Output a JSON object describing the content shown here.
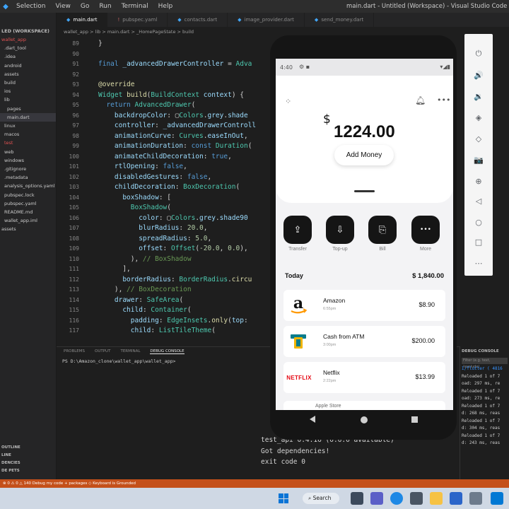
{
  "window": {
    "menu": [
      "Selection",
      "View",
      "Go",
      "Run",
      "Terminal",
      "Help"
    ],
    "title": "main.dart - Untitled (Workspace) - Visual Studio Code"
  },
  "explorer": {
    "workspace_title": "LED (WORKSPACE)",
    "items": [
      {
        "label": "wallet_app",
        "color": "red"
      },
      {
        "label": ".dart_tool"
      },
      {
        "label": ".idea"
      },
      {
        "label": "android"
      },
      {
        "label": "assets"
      },
      {
        "label": "build"
      },
      {
        "label": "ios"
      },
      {
        "label": "lib"
      },
      {
        "label": "pages"
      },
      {
        "label": "main.dart",
        "selected": true
      },
      {
        "label": "linux"
      },
      {
        "label": "macos"
      },
      {
        "label": "test",
        "color": "red"
      },
      {
        "label": "web"
      },
      {
        "label": "windows"
      },
      {
        "label": ".gitignore"
      },
      {
        "label": ".metadata"
      },
      {
        "label": "analysis_options.yaml"
      },
      {
        "label": "pubspec.lock"
      },
      {
        "label": "pubspec.yaml"
      },
      {
        "label": "README.md"
      },
      {
        "label": "wallet_app.iml"
      },
      {
        "label": "assets"
      }
    ],
    "bottom_sections": [
      "OUTLINE",
      "LINE",
      "DENCIES",
      "DE PETS"
    ]
  },
  "tabs": [
    {
      "label": "main.dart",
      "active": true
    },
    {
      "label": "pubspec.yaml"
    },
    {
      "label": "contacts.dart"
    },
    {
      "label": "image_provider.dart"
    },
    {
      "label": "send_money.dart"
    }
  ],
  "breadcrumb": "wallet_app > lib > main.dart > _HomePageState > build",
  "editor": {
    "lines": [
      {
        "n": "89",
        "html": "}"
      },
      {
        "n": "90",
        "html": ""
      },
      {
        "n": "91",
        "html": "<span class=\"kw\">final</span> <span class=\"va\">_advancedDrawerController</span> = <span class=\"ty\">Adva</span>"
      },
      {
        "n": "92",
        "html": ""
      },
      {
        "n": "93",
        "html": "<span class=\"fn\">@override</span>"
      },
      {
        "n": "94",
        "html": "<span class=\"ty\">Widget</span> <span class=\"fn\">build</span>(<span class=\"ty\">BuildContext</span> <span class=\"va\">context</span>) {"
      },
      {
        "n": "95",
        "html": "&nbsp;&nbsp;<span class=\"kw\">return</span> <span class=\"ty\">AdvancedDrawer</span>("
      },
      {
        "n": "96",
        "html": "&nbsp;&nbsp;&nbsp;&nbsp;<span class=\"pr\">backdropColor</span>: ▢<span class=\"ty\">Colors</span>.<span class=\"va\">grey</span>.<span class=\"va\">shade</span>"
      },
      {
        "n": "97",
        "html": "&nbsp;&nbsp;&nbsp;&nbsp;<span class=\"pr\">controller</span>: <span class=\"va\">_advancedDrawerControll</span>"
      },
      {
        "n": "98",
        "html": "&nbsp;&nbsp;&nbsp;&nbsp;<span class=\"pr\">animationCurve</span>: <span class=\"ty\">Curves</span>.<span class=\"va\">easeInOut</span>,"
      },
      {
        "n": "99",
        "html": "&nbsp;&nbsp;&nbsp;&nbsp;<span class=\"pr\">animationDuration</span>: <span class=\"kw\">const</span> <span class=\"ty\">Duration</span>("
      },
      {
        "n": "100",
        "html": "&nbsp;&nbsp;&nbsp;&nbsp;<span class=\"pr\">animateChildDecoration</span>: <span class=\"kw\">true</span>,"
      },
      {
        "n": "101",
        "html": "&nbsp;&nbsp;&nbsp;&nbsp;<span class=\"pr\">rtlOpening</span>: <span class=\"kw\">false</span>,"
      },
      {
        "n": "102",
        "html": "&nbsp;&nbsp;&nbsp;&nbsp;<span class=\"pr\">disabledGestures</span>: <span class=\"kw\">false</span>,"
      },
      {
        "n": "103",
        "html": "&nbsp;&nbsp;&nbsp;&nbsp;<span class=\"pr\">childDecoration</span>: <span class=\"ty\">BoxDecoration</span>("
      },
      {
        "n": "104",
        "html": "&nbsp;&nbsp;&nbsp;&nbsp;&nbsp;&nbsp;<span class=\"pr\">boxShadow</span>: ["
      },
      {
        "n": "105",
        "html": "&nbsp;&nbsp;&nbsp;&nbsp;&nbsp;&nbsp;&nbsp;&nbsp;<span class=\"ty\">BoxShadow</span>("
      },
      {
        "n": "106",
        "html": "&nbsp;&nbsp;&nbsp;&nbsp;&nbsp;&nbsp;&nbsp;&nbsp;&nbsp;&nbsp;<span class=\"pr\">color</span>: ▢<span class=\"ty\">Colors</span>.<span class=\"va\">grey</span>.<span class=\"va\">shade90</span>"
      },
      {
        "n": "107",
        "html": "&nbsp;&nbsp;&nbsp;&nbsp;&nbsp;&nbsp;&nbsp;&nbsp;&nbsp;&nbsp;<span class=\"pr\">blurRadius</span>: <span class=\"nu\">20.0</span>,"
      },
      {
        "n": "108",
        "html": "&nbsp;&nbsp;&nbsp;&nbsp;&nbsp;&nbsp;&nbsp;&nbsp;&nbsp;&nbsp;<span class=\"pr\">spreadRadius</span>: <span class=\"nu\">5.0</span>,"
      },
      {
        "n": "109",
        "html": "&nbsp;&nbsp;&nbsp;&nbsp;&nbsp;&nbsp;&nbsp;&nbsp;&nbsp;&nbsp;<span class=\"pr\">offset</span>: <span class=\"ty\">Offset</span>(<span class=\"nu\">-20.0</span>, <span class=\"nu\">0.0</span>),"
      },
      {
        "n": "110",
        "html": "&nbsp;&nbsp;&nbsp;&nbsp;&nbsp;&nbsp;&nbsp;&nbsp;), <span class=\"cm\">// BoxShadow</span>"
      },
      {
        "n": "111",
        "html": "&nbsp;&nbsp;&nbsp;&nbsp;&nbsp;&nbsp;],"
      },
      {
        "n": "112",
        "html": "&nbsp;&nbsp;&nbsp;&nbsp;&nbsp;&nbsp;<span class=\"pr\">borderRadius</span>: <span class=\"ty\">BorderRadius</span>.<span class=\"fn\">circu</span>"
      },
      {
        "n": "113",
        "html": "&nbsp;&nbsp;&nbsp;&nbsp;), <span class=\"cm\">// BoxDecoration</span>"
      },
      {
        "n": "114",
        "html": "&nbsp;&nbsp;&nbsp;&nbsp;<span class=\"pr\">drawer</span>: <span class=\"ty\">SafeArea</span>("
      },
      {
        "n": "115",
        "html": "&nbsp;&nbsp;&nbsp;&nbsp;&nbsp;&nbsp;<span class=\"pr\">child</span>: <span class=\"ty\">Container</span>("
      },
      {
        "n": "116",
        "html": "&nbsp;&nbsp;&nbsp;&nbsp;&nbsp;&nbsp;&nbsp;&nbsp;<span class=\"pr\">padding</span>: <span class=\"ty\">EdgeInsets</span>.<span class=\"fn\">only</span>(<span class=\"pr\">top</span>:"
      },
      {
        "n": "117",
        "html": "&nbsp;&nbsp;&nbsp;&nbsp;&nbsp;&nbsp;&nbsp;&nbsp;<span class=\"pr\">child</span>: <span class=\"ty\">ListTileTheme</span>("
      }
    ]
  },
  "panel": {
    "tabs": [
      "PROBLEMS",
      "OUTPUT",
      "TERMINAL",
      "DEBUG CONSOLE"
    ],
    "active_tab": "DEBUG CONSOLE",
    "terminal_prompt": "PS D:\\Amazon_clone\\wallet_app\\wallet_app>",
    "output_lines": [
      "test_api 0.4.16 (0.6.0 available)",
      "Got dependencies!",
      "exit code 0"
    ],
    "debug_title": "DEBUG CONSOLE",
    "debug_filter": "Filter (e.g. text, !exclude)",
    "debug_lines": [
      {
        "text": "I/flutter ( 4816",
        "blue": true
      },
      {
        "text": "Reloaded 1 of 7"
      },
      {
        "text": "oad: 297 ms, re"
      },
      {
        "text": "Reloaded 1 of 7"
      },
      {
        "text": "oad: 273 ms, re"
      },
      {
        "text": "Reloaded 1 of 7"
      },
      {
        "text": "d: 268 ms, reas"
      },
      {
        "text": "Reloaded 1 of 7"
      },
      {
        "text": "d: 304 ms, reas"
      },
      {
        "text": "Reloaded 1 of 7"
      },
      {
        "text": "d: 243 ms, reas"
      }
    ]
  },
  "statusbar": {
    "text": "⊗ 0 ⚠ 0 △ 140    Debug my code + packages    ◇ Keyboard is Grounded"
  },
  "taskbar": {
    "search_label": "Search"
  },
  "emulator_toolbar": {
    "buttons": [
      {
        "name": "power-icon",
        "glyph": "⏻"
      },
      {
        "name": "volume-up-icon",
        "glyph": "🔊"
      },
      {
        "name": "volume-down-icon",
        "glyph": "🔉"
      },
      {
        "name": "rotate-left-icon",
        "glyph": "◈"
      },
      {
        "name": "rotate-right-icon",
        "glyph": "◇"
      },
      {
        "name": "camera-icon",
        "glyph": "📷"
      },
      {
        "name": "zoom-icon",
        "glyph": "⊕"
      },
      {
        "name": "back-icon",
        "glyph": "◁"
      },
      {
        "name": "home-icon",
        "glyph": "○"
      },
      {
        "name": "overview-icon",
        "glyph": "□"
      },
      {
        "name": "more-icon",
        "glyph": "⋯"
      }
    ]
  },
  "phone": {
    "status_time": "4:40",
    "currency": "$",
    "balance": "1224.00",
    "add_money_label": "Add Money",
    "actions": [
      {
        "label": "Transfer",
        "glyph": "⇪"
      },
      {
        "label": "Top-up",
        "glyph": "⇩"
      },
      {
        "label": "Bill",
        "glyph": "⎘"
      },
      {
        "label": "More",
        "glyph": "•••"
      }
    ],
    "day_label": "Today",
    "day_total": "$ 1,840.00",
    "transactions": [
      {
        "name": "Amazon",
        "time": "6:55pm",
        "amount": "$8.90"
      },
      {
        "name": "Cash from ATM",
        "time": "3:00pm",
        "amount": "$200.00"
      },
      {
        "name": "Netflix",
        "time": "2:22pm",
        "amount": "$13.99"
      }
    ],
    "partial_item": "Apple Store",
    "netflix_logo_text": "NETFLIX"
  }
}
